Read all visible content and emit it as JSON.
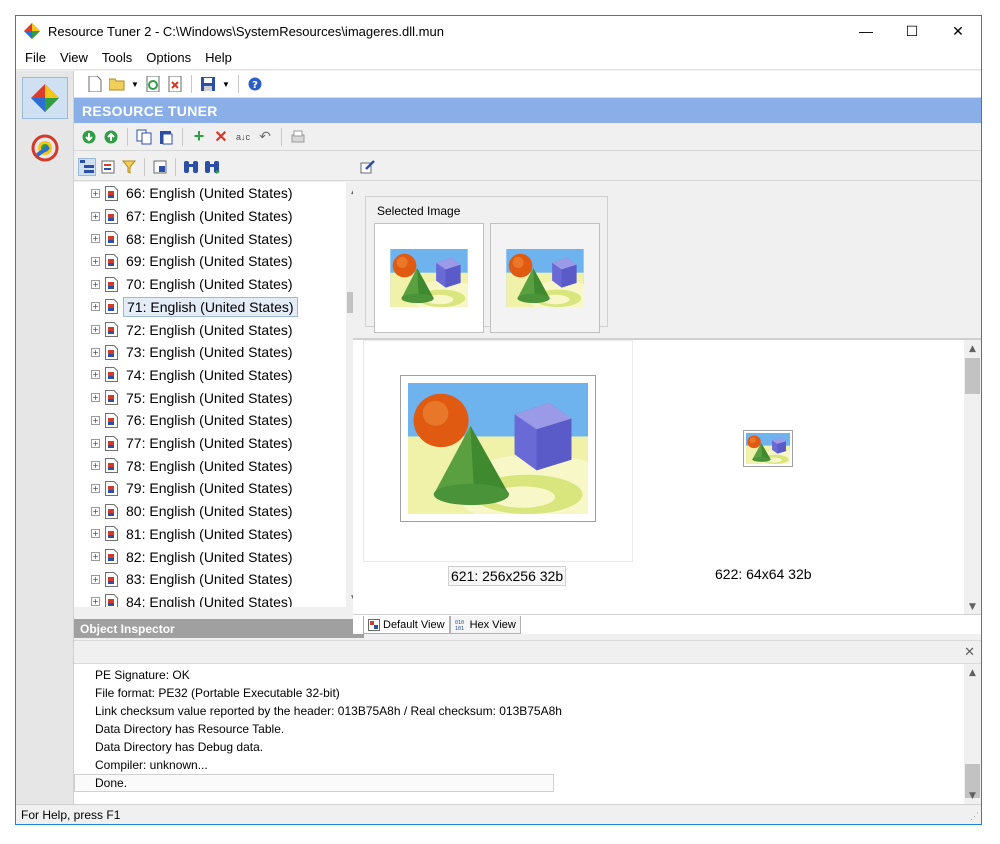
{
  "window": {
    "title": "Resource Tuner 2 - C:\\Windows\\SystemResources\\imageres.dll.mun",
    "minimize": "—",
    "maximize": "☐",
    "close": "✕"
  },
  "menu": [
    "File",
    "View",
    "Tools",
    "Options",
    "Help"
  ],
  "header": {
    "title": "RESOURCE TUNER"
  },
  "tree": {
    "items": [
      "66: English (United States)",
      "67: English (United States)",
      "68: English (United States)",
      "69: English (United States)",
      "70: English (United States)",
      "71: English (United States)",
      "72: English (United States)",
      "73: English (United States)",
      "74: English (United States)",
      "75: English (United States)",
      "76: English (United States)",
      "77: English (United States)",
      "78: English (United States)",
      "79: English (United States)",
      "80: English (United States)",
      "81: English (United States)",
      "82: English (United States)",
      "83: English (United States)",
      "84: English (United States)"
    ],
    "selected_index": 5
  },
  "object_inspector": {
    "title": "Object Inspector"
  },
  "selected_image": {
    "label": "Selected Image"
  },
  "preview": {
    "caption_large": "621: 256x256 32b",
    "caption_small": "622: 64x64 32b"
  },
  "tabs": {
    "default_view": "Default View",
    "hex_view": "Hex View"
  },
  "log": {
    "lines": [
      "PE Signature: OK",
      "File format: PE32 (Portable Executable 32-bit)",
      "Link checksum value reported by the header: 013B75A8h / Real checksum: 013B75A8h",
      "Data Directory has Resource Table.",
      "Data Directory has Debug data.",
      "Compiler: unknown...",
      "Done."
    ]
  },
  "status": {
    "text": "For Help, press F1"
  },
  "colors": {
    "header_bg": "#8aaee8",
    "accent": "#1883d7",
    "selection": "#e4ecf7"
  }
}
